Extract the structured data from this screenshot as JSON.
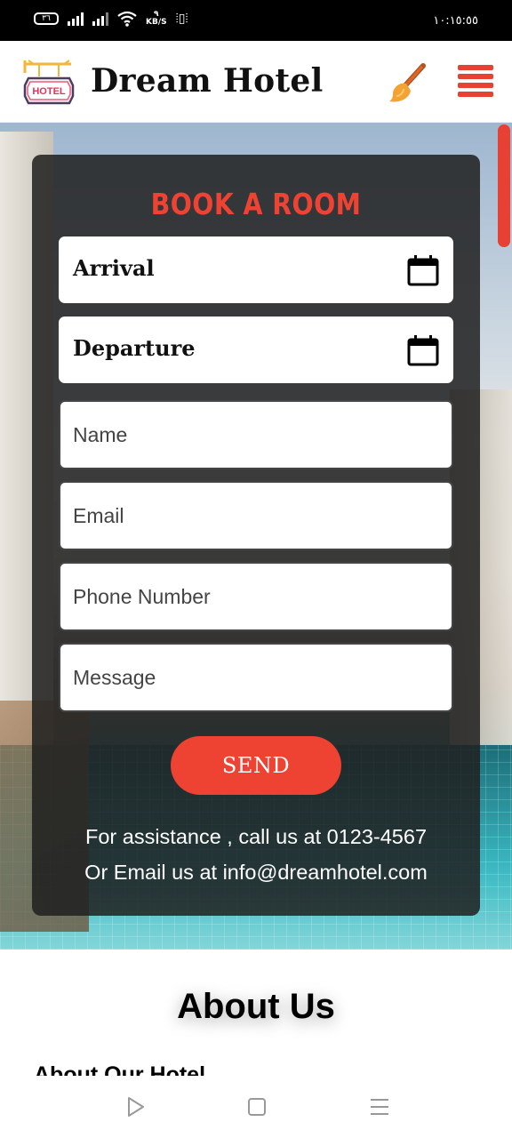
{
  "status_bar": {
    "battery": "٣٦",
    "speed_value": "٩",
    "speed_unit": "KB/S",
    "time": "١٠:١٥:٥٥"
  },
  "header": {
    "logo_text": "HOTEL",
    "brand": "Dream Hotel",
    "theme_icon": "paint-brush-icon",
    "menu_icon": "hamburger-menu-icon"
  },
  "booking": {
    "title": "BOOK A ROOM",
    "arrival_label": "Arrival",
    "departure_label": "Departure",
    "calendar_icon": "calendar-icon",
    "name_placeholder": "Name",
    "email_placeholder": "Email",
    "phone_placeholder": "Phone Number",
    "message_placeholder": "Message",
    "send_label": "SEND",
    "assist_line1": "For assistance , call us at 0123-4567",
    "assist_line2": "Or Email us at info@dreamhotel.com"
  },
  "about": {
    "title": "About Us",
    "subtitle": "About Our Hotel"
  },
  "nav_bar": {
    "back_icon": "play-triangle-icon",
    "home_icon": "square-home-icon",
    "recents_icon": "menu-lines-icon"
  },
  "colors": {
    "accent": "#ee4233",
    "card": "#202020",
    "text_dark": "#111111"
  }
}
